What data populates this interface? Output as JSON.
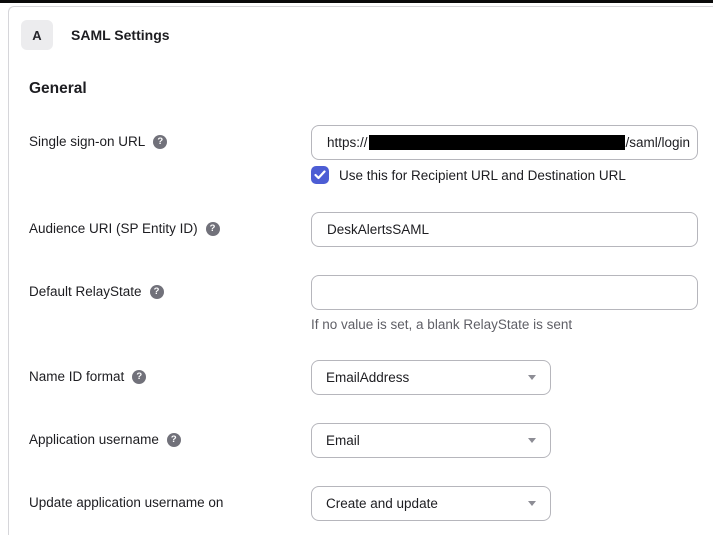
{
  "panel": {
    "badge": "A",
    "title": "SAML Settings"
  },
  "section_title": "General",
  "glyphs": {
    "help": "?"
  },
  "fields": {
    "sso_url": {
      "label": "Single sign-on URL",
      "value_prefix": "https://",
      "value_redacted": true,
      "value_suffix": "/saml/login",
      "checkbox": {
        "checked": true,
        "label": "Use this for Recipient URL and Destination URL"
      }
    },
    "audience_uri": {
      "label": "Audience URI (SP Entity ID)",
      "value": "DeskAlertsSAML"
    },
    "default_relaystate": {
      "label": "Default RelayState",
      "value": "",
      "hint": "If no value is set, a blank RelayState is sent"
    },
    "name_id_format": {
      "label": "Name ID format",
      "value": "EmailAddress"
    },
    "application_username": {
      "label": "Application username",
      "value": "Email"
    },
    "update_app_username_on": {
      "label": "Update application username on",
      "value": "Create and update"
    }
  },
  "colors": {
    "checkbox_accent": "#4c5dd4",
    "help_icon_bg": "#71717a",
    "panel_border": "#d6d6da",
    "input_border": "#b6b6bc",
    "redaction": "#000000",
    "hint_text": "#5f5f66",
    "top_bar": "#0a0a0a"
  }
}
